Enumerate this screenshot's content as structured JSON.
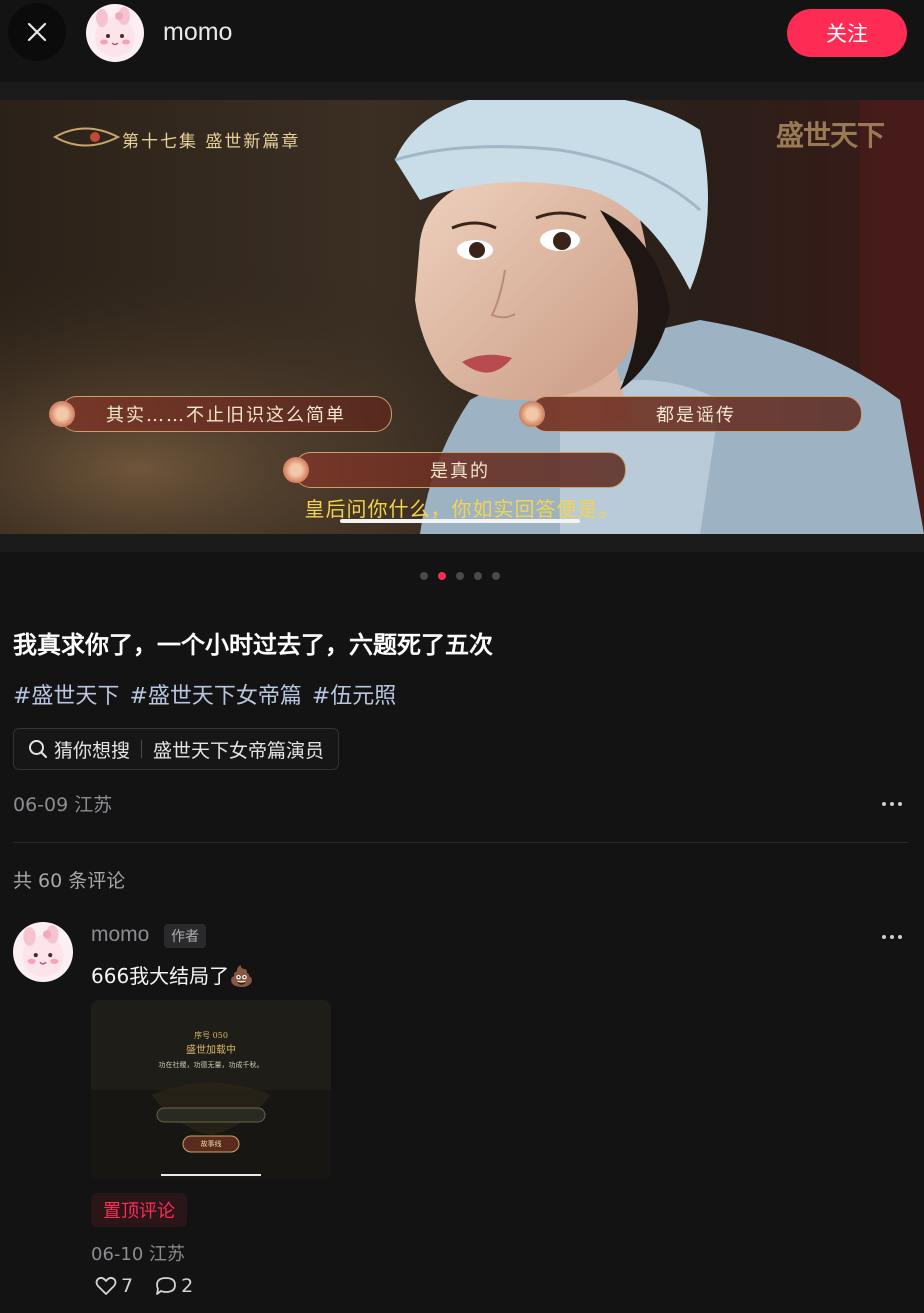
{
  "header": {
    "username": "momo",
    "follow_label": "关注"
  },
  "media": {
    "episode_title": "第十七集 盛世新篇章",
    "logo_text": "盛世天下",
    "choices": [
      "其实……不止旧识这么简单",
      "都是谣传",
      "是真的"
    ],
    "subtitle": "皇后问你什么，你如实回答便是。",
    "page_count": 5,
    "active_page": 2,
    "video_progress": 0.26
  },
  "post": {
    "title": "我真求你了，一个小时过去了，六题死了五次",
    "tags": [
      "#盛世天下",
      "#盛世天下女帝篇",
      "#伍元照"
    ],
    "search_prefix": "猜你想搜",
    "search_term": "盛世天下女帝篇演员",
    "date_location": "06-09 江苏"
  },
  "comments": {
    "count_label": "共 60 条评论",
    "items": [
      {
        "author": "momo",
        "badge": "作者",
        "text": "666我大结局了",
        "emoji": "💩",
        "image_text": {
          "line1": "序号 050",
          "line2": "盛世加载中",
          "line3": "功在社稷，功德无量，功成千秋。",
          "button": "故事线"
        },
        "pinned_label": "置顶评论",
        "date_location": "06-10 江苏",
        "likes": "7",
        "replies": "2"
      }
    ]
  },
  "colors": {
    "accent": "#fe2c55",
    "background": "#131314",
    "tag": "#b9c6e0",
    "subtitle": "#f3d44f"
  },
  "icons": [
    "close-icon",
    "search-icon",
    "more-icon",
    "heart-icon",
    "comment-icon"
  ]
}
